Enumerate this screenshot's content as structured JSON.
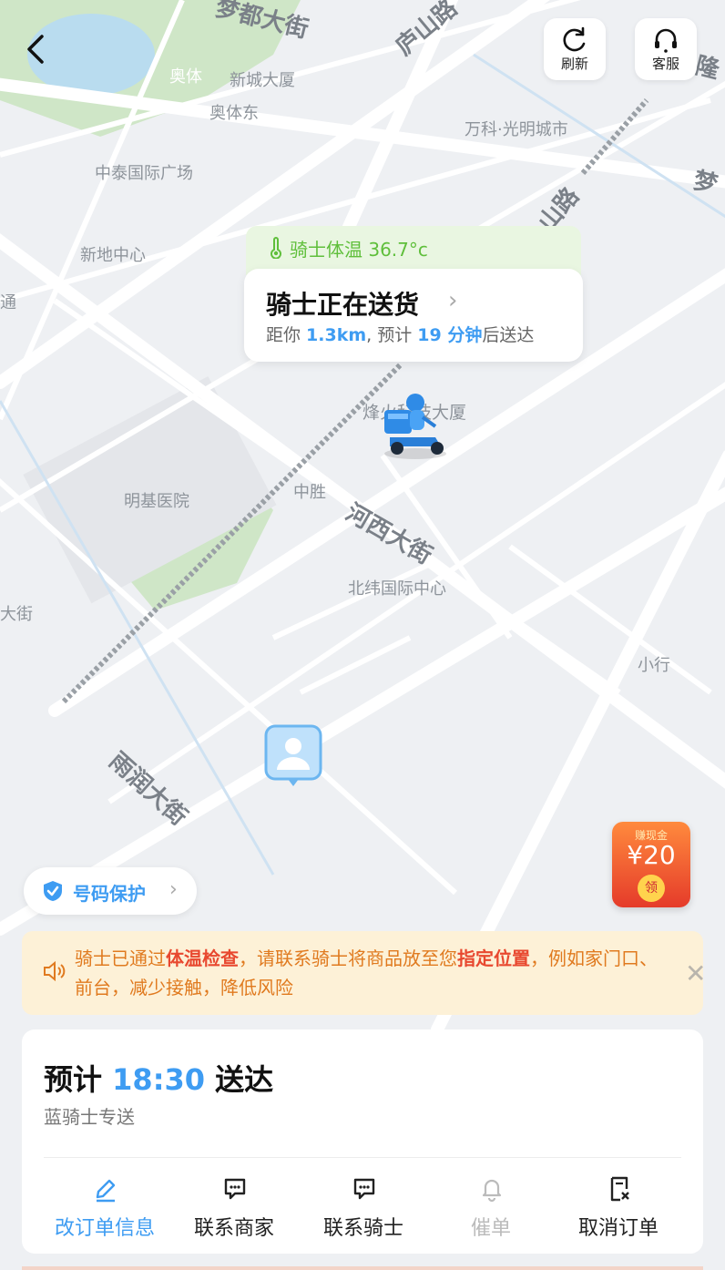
{
  "header": {
    "refresh_label": "刷新",
    "service_label": "客服"
  },
  "map": {
    "labels": [
      "奥体",
      "新城大厦",
      "奥体东",
      "万科·光明城市",
      "中泰国际广场",
      "新地中心",
      "明基医院",
      "中胜",
      "北纬国际中心",
      "小行",
      "通",
      "大街"
    ],
    "roads": [
      "梦都大街",
      "庐山路",
      "河西大街",
      "雨润大街",
      "隆",
      "梦",
      "山路"
    ]
  },
  "rider": {
    "temperature_text": "骑士体温 36.7°c",
    "status_title": "骑士正在送货",
    "distance_prefix": "距你 ",
    "distance": "1.3km",
    "eta_middle": ", 预计 ",
    "eta_minutes": "19 分钟",
    "eta_suffix": "后送达",
    "landmark": "烽火科技大厦"
  },
  "promo": {
    "top_text": "赚现金",
    "amount": "¥20",
    "claim": "领"
  },
  "privacy": {
    "label": "号码保护"
  },
  "notice": {
    "part1": "骑士已通过",
    "highlight1": "体温检查",
    "part2": "，请联系骑士将商品放至您",
    "highlight2": "指定位置",
    "part3": "，例如家门口、前台，减少接触，降低风险"
  },
  "order": {
    "eta_prefix": "预计 ",
    "eta_time": "18:30",
    "eta_suffix": " 送达",
    "service": "蓝骑士专送"
  },
  "actions": [
    {
      "label": "改订单信息",
      "color": "#3e9cf2"
    },
    {
      "label": "联系商家",
      "color": "#222222"
    },
    {
      "label": "联系骑士",
      "color": "#222222"
    },
    {
      "label": "催单",
      "color": "#bbbbbb"
    },
    {
      "label": "取消订单",
      "color": "#222222"
    }
  ],
  "colors": {
    "accent": "#3e9cf2",
    "warning_text": "#e07a1f",
    "highlight": "#e8482f",
    "temperature_green": "#5fbf3b"
  }
}
